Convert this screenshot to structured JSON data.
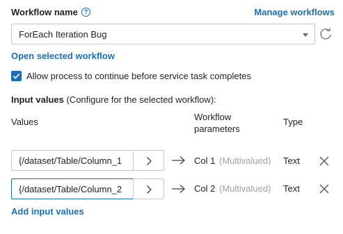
{
  "header": {
    "workflow_name_label": "Workflow name",
    "help_icon": "?",
    "manage_link": "Manage workflows"
  },
  "workflow_select": {
    "value": "ForEach Iteration Bug"
  },
  "open_link": "Open selected workflow",
  "allow_checkbox": {
    "checked": true,
    "label": "Allow process to continue before service task completes"
  },
  "input_values": {
    "heading_bold": "Input values",
    "heading_rest": " (Configure for the selected workflow):",
    "columns": {
      "values": "Values",
      "params_line1": "Workflow",
      "params_line2": "parameters",
      "type": "Type"
    },
    "rows": [
      {
        "value": "{/dataset/Table/Column_1",
        "param": "Col 1",
        "multivalued": "(Multivalued)",
        "type": "Text",
        "focused": false
      },
      {
        "value": "{/dataset/Table/Column_2",
        "param": "Col 2",
        "multivalued": "(Multivalued)",
        "type": "Text",
        "focused": true
      }
    ]
  },
  "add_link": "Add input values",
  "colors": {
    "accent": "#1a6fb8",
    "muted": "#a19f9d",
    "border": "#c8c6c4"
  },
  "icons": [
    "help-icon",
    "caret-down-icon",
    "refresh-icon",
    "check-icon",
    "chevron-right-icon",
    "arrow-right-icon",
    "close-icon"
  ]
}
